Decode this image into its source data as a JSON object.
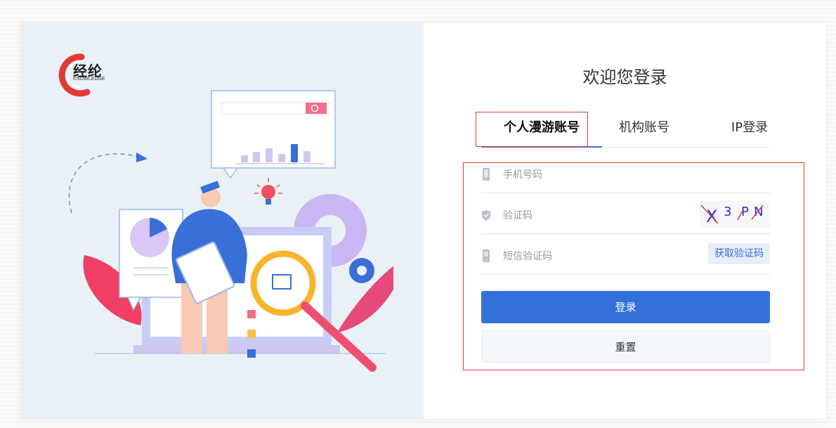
{
  "brand": {
    "name": "经纶",
    "subtitle": "KNOWLEDGE",
    "colors": {
      "primary": "#3370d9",
      "brand_red": "#e53935",
      "outline_red": "#e03a3a"
    }
  },
  "login": {
    "welcome_title": "欢迎您登录",
    "tabs": [
      {
        "label": "个人漫游账号",
        "active": true
      },
      {
        "label": "机构账号",
        "active": false
      },
      {
        "label": "IP登录",
        "active": false
      }
    ],
    "fields": {
      "phone": {
        "placeholder": "手机号码",
        "icon": "phone-icon"
      },
      "captcha": {
        "placeholder": "验证码",
        "icon": "shield-icon",
        "captcha_text": [
          "X",
          "3",
          "P",
          "N"
        ]
      },
      "sms": {
        "placeholder": "短信验证码",
        "icon": "sms-phone-icon",
        "button_label": "获取验证码"
      }
    },
    "buttons": {
      "login_label": "登录",
      "reset_label": "重置"
    }
  }
}
